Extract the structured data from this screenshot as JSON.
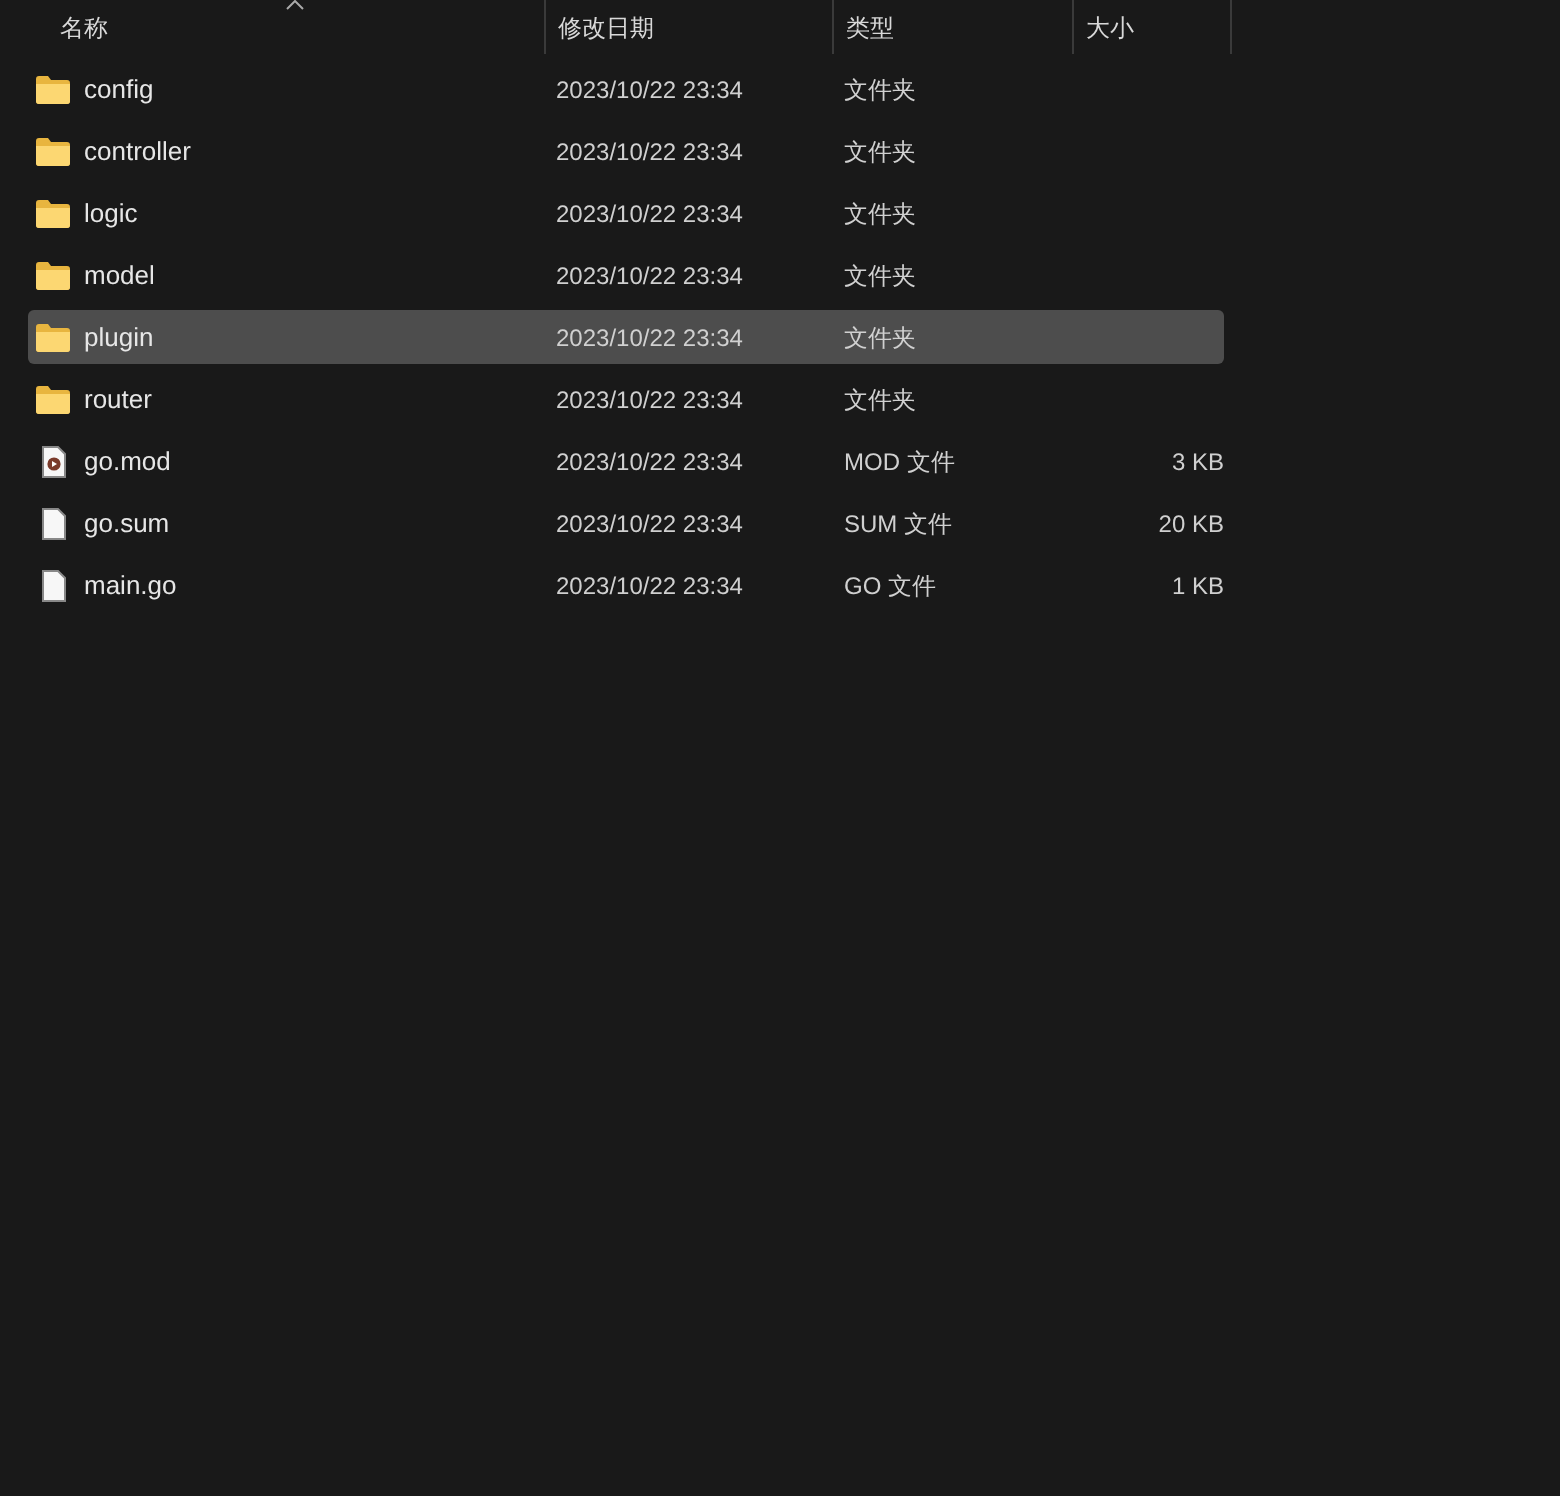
{
  "columns": [
    {
      "label": "名称",
      "sorted": true
    },
    {
      "label": "修改日期",
      "sorted": false
    },
    {
      "label": "类型",
      "sorted": false
    },
    {
      "label": "大小",
      "sorted": false
    }
  ],
  "rows": [
    {
      "kind": "folder",
      "name": "config",
      "modified": "2023/10/22 23:34",
      "type": "文件夹",
      "selected": false
    },
    {
      "kind": "folder",
      "name": "controller",
      "modified": "2023/10/22 23:34",
      "type": "文件夹",
      "selected": false
    },
    {
      "kind": "folder",
      "name": "logic",
      "modified": "2023/10/22 23:34",
      "type": "文件夹",
      "selected": false
    },
    {
      "kind": "folder",
      "name": "model",
      "modified": "2023/10/22 23:34",
      "type": "文件夹",
      "selected": false
    },
    {
      "kind": "folder",
      "name": "plugin",
      "modified": "2023/10/22 23:34",
      "type": "文件夹",
      "selected": true
    },
    {
      "kind": "folder",
      "name": "router",
      "modified": "2023/10/22 23:34",
      "type": "文件夹",
      "selected": false
    },
    {
      "kind": "media-file",
      "name": "go.mod",
      "modified": "2023/10/22 23:34",
      "type": "MOD 文件",
      "size": "3 KB",
      "selected": false
    },
    {
      "kind": "file",
      "name": "go.sum",
      "modified": "2023/10/22 23:34",
      "type": "SUM 文件",
      "size": "20 KB",
      "selected": false
    },
    {
      "kind": "file",
      "name": "main.go",
      "modified": "2023/10/22 23:34",
      "type": "GO 文件",
      "size": "1 KB",
      "selected": false
    }
  ]
}
